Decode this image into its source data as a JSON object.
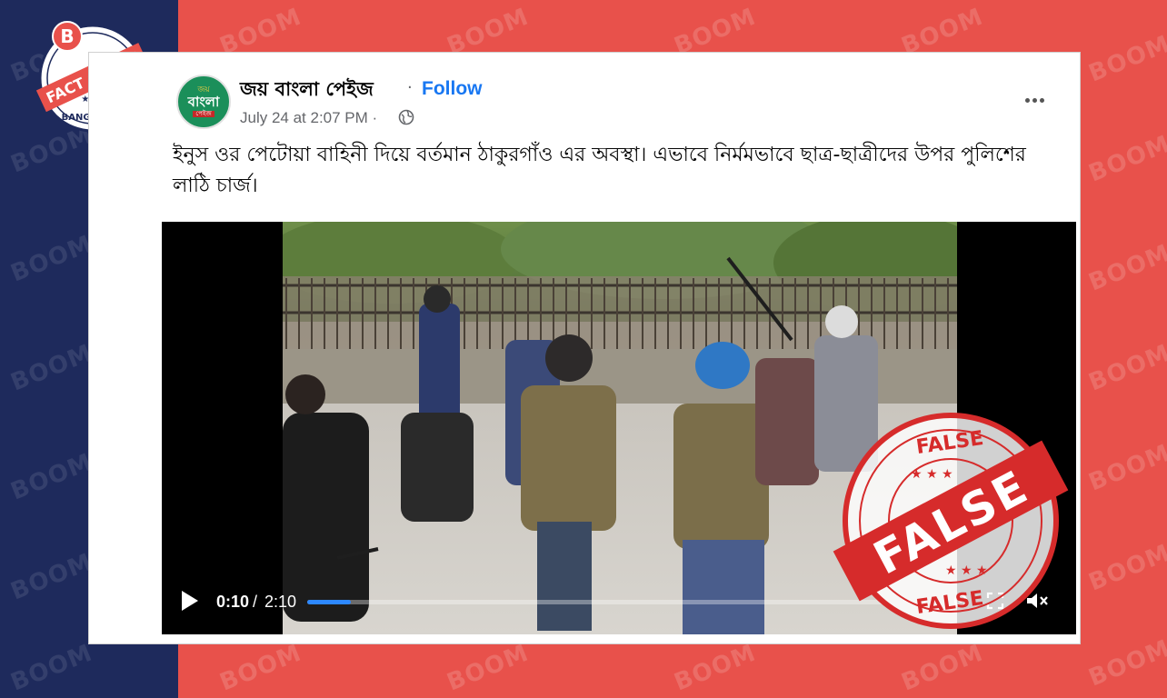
{
  "watermark": {
    "text": "BOOM"
  },
  "badge": {
    "letter": "B",
    "line1": "FACT CHECK",
    "line2": "BANGLADESH"
  },
  "post": {
    "avatar": {
      "line1": "জয়",
      "line2": "বাংলা",
      "line3": "পেইজ"
    },
    "page_name": "জয় বাংলা পেইজ",
    "separator": "·",
    "follow_label": "Follow",
    "timestamp": "July 24 at 2:07 PM ·",
    "privacy_icon": "globe-icon",
    "more_icon": "more-options-icon",
    "text": "ইনুস ওর পেটোয়া বাহিনী দিয়ে বর্তমান ঠাকুরগাঁও এর অবস্থা। এভাবে নির্মমভাবে ছাত্র-ছাত্রীদের উপর পুলিশের লাঠি চার্জ।"
  },
  "video": {
    "current_time": "0:10",
    "separator": "/",
    "total_time": "2:10",
    "progress": 0.075,
    "colors": {
      "progress": "#2d88ff"
    },
    "controls": [
      "play-icon",
      "settings-icon",
      "fullscreen-icon",
      "volume-mute-icon"
    ]
  },
  "stamp": {
    "top": "FALSE",
    "center": "FALSE",
    "bottom": "FALSE",
    "color": "#d62b2b"
  },
  "colors": {
    "navy": "#1e2a5c",
    "red_bg": "#e8514b",
    "facebook_blue": "#1877f2"
  }
}
